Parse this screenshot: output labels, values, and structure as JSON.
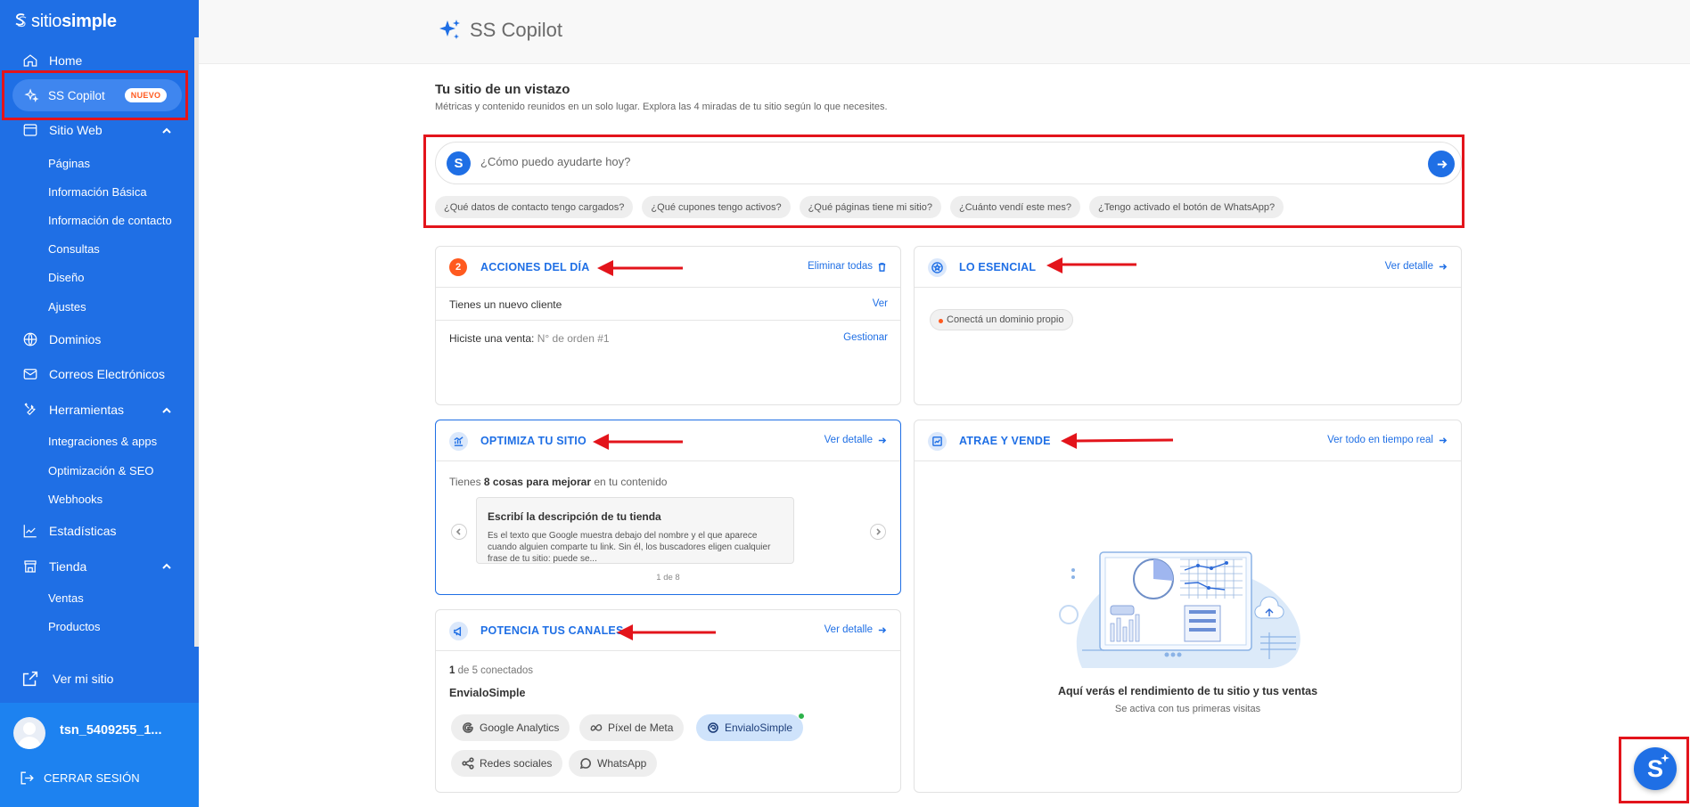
{
  "brand": {
    "part1": "sitio",
    "part2": "simple"
  },
  "sidebar": {
    "home": "Home",
    "copilot": "SS Copilot",
    "copilot_badge": "NUEVO",
    "sitio_web": "Sitio Web",
    "sitio_web_items": [
      "Páginas",
      "Información Básica",
      "Información de contacto",
      "Consultas",
      "Diseño",
      "Ajustes"
    ],
    "dominios": "Dominios",
    "correos": "Correos Electrónicos",
    "herramientas": "Herramientas",
    "herramientas_items": [
      "Integraciones & apps",
      "Optimización & SEO",
      "Webhooks"
    ],
    "estadisticas": "Estadísticas",
    "tienda": "Tienda",
    "tienda_items": [
      "Ventas",
      "Productos"
    ],
    "ver_sitio": "Ver mi sitio",
    "user_name": "tsn_5409255_1...",
    "logout": "CERRAR SESIÓN"
  },
  "header": {
    "title": "SS Copilot"
  },
  "overview": {
    "title": "Tu sitio de un vistazo",
    "subtitle": "Métricas y contenido reunidos en un solo lugar. Explora las 4 miradas de tu sitio según lo que necesites."
  },
  "ask": {
    "placeholder": "¿Cómo puedo ayudarte hoy?",
    "suggestions": [
      "¿Qué datos de contacto tengo cargados?",
      "¿Qué cupones tengo activos?",
      "¿Qué páginas tiene mi sitio?",
      "¿Cuánto vendí este mes?",
      "¿Tengo activado el botón de WhatsApp?"
    ]
  },
  "acciones": {
    "count": "2",
    "title": "ACCIONES DEL DÍA",
    "link": "Eliminar todas",
    "row1": {
      "text": "Tienes un nuevo cliente",
      "action": "Ver"
    },
    "row2": {
      "text": "Hiciste una venta:",
      "detail": "N° de orden #1",
      "action": "Gestionar"
    }
  },
  "esencial": {
    "title": "LO ESENCIAL",
    "link": "Ver detalle",
    "chip": "Conectá un dominio propio"
  },
  "optimiza": {
    "title": "OPTIMIZA TU SITIO",
    "link": "Ver detalle",
    "text_pre": "Tienes",
    "text_bold": "8 cosas para mejorar",
    "text_post": "en tu contenido",
    "tip_title": "Escribí la descripción de tu tienda",
    "tip_desc": "Es el texto que Google muestra debajo del nombre y el que aparece cuando alguien comparte tu link. Sin él, los buscadores eligen cualquier frase de tu sitio: puede se...",
    "pager": "1 de 8"
  },
  "atrae": {
    "title": "ATRAE Y VENDE",
    "link": "Ver todo en tiempo real",
    "empty_title": "Aquí verás el rendimiento de tu sitio y tus ventas",
    "empty_sub": "Se activa con tus primeras visitas"
  },
  "canales": {
    "title": "POTENCIA TUS CANALES",
    "link": "Ver detalle",
    "count": "1",
    "count_suffix": "de 5 conectados",
    "connected_name": "EnvialoSimple",
    "services": [
      "Google Analytics",
      "Píxel de Meta",
      "EnvialoSimple",
      "Redes sociales",
      "WhatsApp"
    ]
  },
  "colors": {
    "primary": "#1f6fe5",
    "accent": "#ff5a1f",
    "highlight": "#e3141b"
  }
}
